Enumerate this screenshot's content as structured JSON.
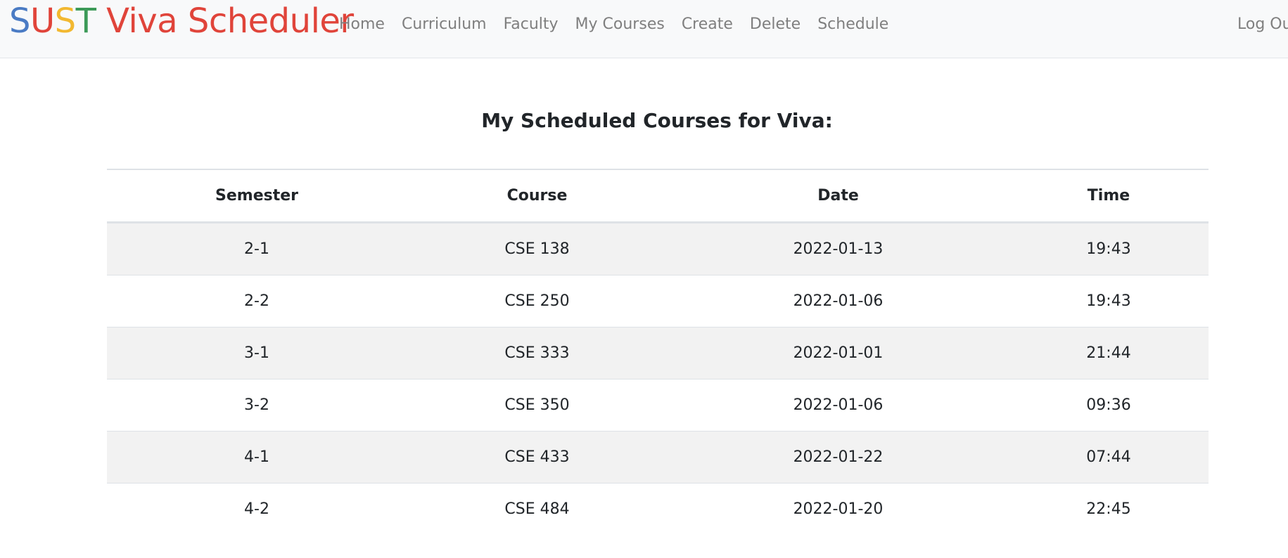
{
  "brand": {
    "letters": [
      {
        "char": "S",
        "color": "#4a7bc4"
      },
      {
        "char": "U",
        "color": "#e0443a"
      },
      {
        "char": "S",
        "color": "#f2b830"
      },
      {
        "char": "T",
        "color": "#3c9a58"
      }
    ],
    "rest": " Viva Scheduler",
    "rest_color": "#e0443a"
  },
  "nav": {
    "items": [
      {
        "label": "Home"
      },
      {
        "label": "Curriculum"
      },
      {
        "label": "Faculty"
      },
      {
        "label": "My Courses"
      },
      {
        "label": "Create"
      },
      {
        "label": "Delete"
      },
      {
        "label": "Schedule"
      }
    ],
    "logout_label": "Log Out"
  },
  "main": {
    "title": "My Scheduled Courses for Viva:",
    "table": {
      "headers": [
        "Semester",
        "Course",
        "Date",
        "Time"
      ],
      "rows": [
        [
          "2-1",
          "CSE 138",
          "2022-01-13",
          "19:43"
        ],
        [
          "2-2",
          "CSE 250",
          "2022-01-06",
          "19:43"
        ],
        [
          "3-1",
          "CSE 333",
          "2022-01-01",
          "21:44"
        ],
        [
          "3-2",
          "CSE 350",
          "2022-01-06",
          "09:36"
        ],
        [
          "4-1",
          "CSE 433",
          "2022-01-22",
          "07:44"
        ],
        [
          "4-2",
          "CSE 484",
          "2022-01-20",
          "22:45"
        ]
      ]
    }
  }
}
